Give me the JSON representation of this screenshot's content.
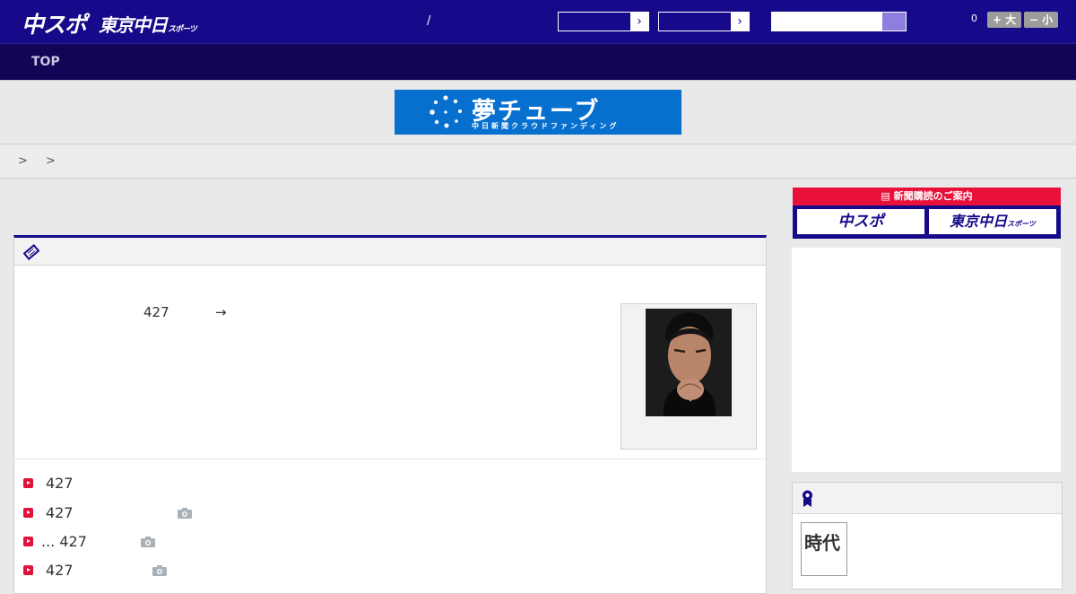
{
  "header": {
    "logo_main": "中スポ",
    "logo_sub": "東京中日",
    "logo_sub_small": "スポーツ",
    "separator": "/",
    "notification_count": "0",
    "font_larger_label": "+ 大",
    "font_smaller_label": "− 小",
    "dropdown_arrow": "›"
  },
  "nav": {
    "items": [
      {
        "label": "TOP"
      }
    ]
  },
  "banner": {
    "title": "夢チューブ",
    "subtitle": "中日新聞クラウドファンディング"
  },
  "breadcrumb": {
    "text": "> >"
  },
  "article": {
    "lead_number": "427",
    "lead_arrow": "→",
    "related": [
      {
        "prefix": "",
        "text": "427",
        "has_photo": false
      },
      {
        "prefix": "",
        "text": "427",
        "has_photo": true
      },
      {
        "prefix": "... ",
        "text": "427",
        "has_photo": true
      },
      {
        "prefix": "",
        "text": "427",
        "has_photo": true
      }
    ]
  },
  "sidebar": {
    "subscribe_title": "新聞購読のご案内",
    "subscribe_options": [
      "中スポ",
      "東京中日"
    ],
    "subscribe_small": "スポーツ",
    "ranking_thumb_text": "時代"
  },
  "colors": {
    "header_bg": "#16098a",
    "nav_bg": "#110557",
    "accent_red": "#e0123a",
    "banner_blue": "#0770cf"
  }
}
